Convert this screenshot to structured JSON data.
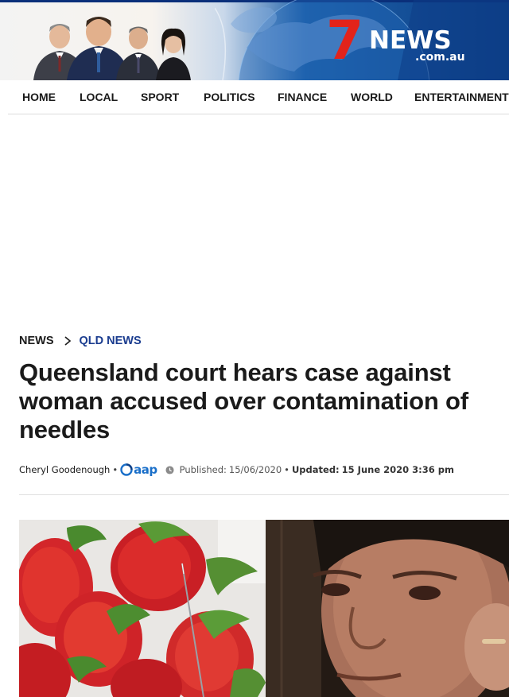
{
  "site": {
    "logo_seven": "7",
    "logo_news": "NEWS",
    "logo_domain": ".com.au"
  },
  "nav": {
    "items": [
      {
        "label": "HOME"
      },
      {
        "label": "LOCAL"
      },
      {
        "label": "SPORT"
      },
      {
        "label": "POLITICS"
      },
      {
        "label": "FINANCE"
      },
      {
        "label": "WORLD"
      },
      {
        "label": "ENTERTAINMENT"
      }
    ]
  },
  "breadcrumb": {
    "items": [
      {
        "label": "NEWS"
      },
      {
        "label": "QLD NEWS"
      }
    ]
  },
  "article": {
    "headline": "Queensland court hears case against woman accused over contamination of needles",
    "author": "Cheryl Goodenough",
    "source_logo": "aap",
    "published_label": "Published:",
    "published_date": "15/06/2020",
    "updated_label": "Updated:",
    "updated_date": "15 June 2020 3:36 pm"
  },
  "icons": {
    "breadcrumb_separator": "chevron-right-icon",
    "published": "clock-icon",
    "source": "aap-logo"
  },
  "colors": {
    "brand_red": "#e2231a",
    "brand_blue": "#0d3f86",
    "breadcrumb_link": "#1a3c8f",
    "aap_blue": "#1a6fc9"
  }
}
